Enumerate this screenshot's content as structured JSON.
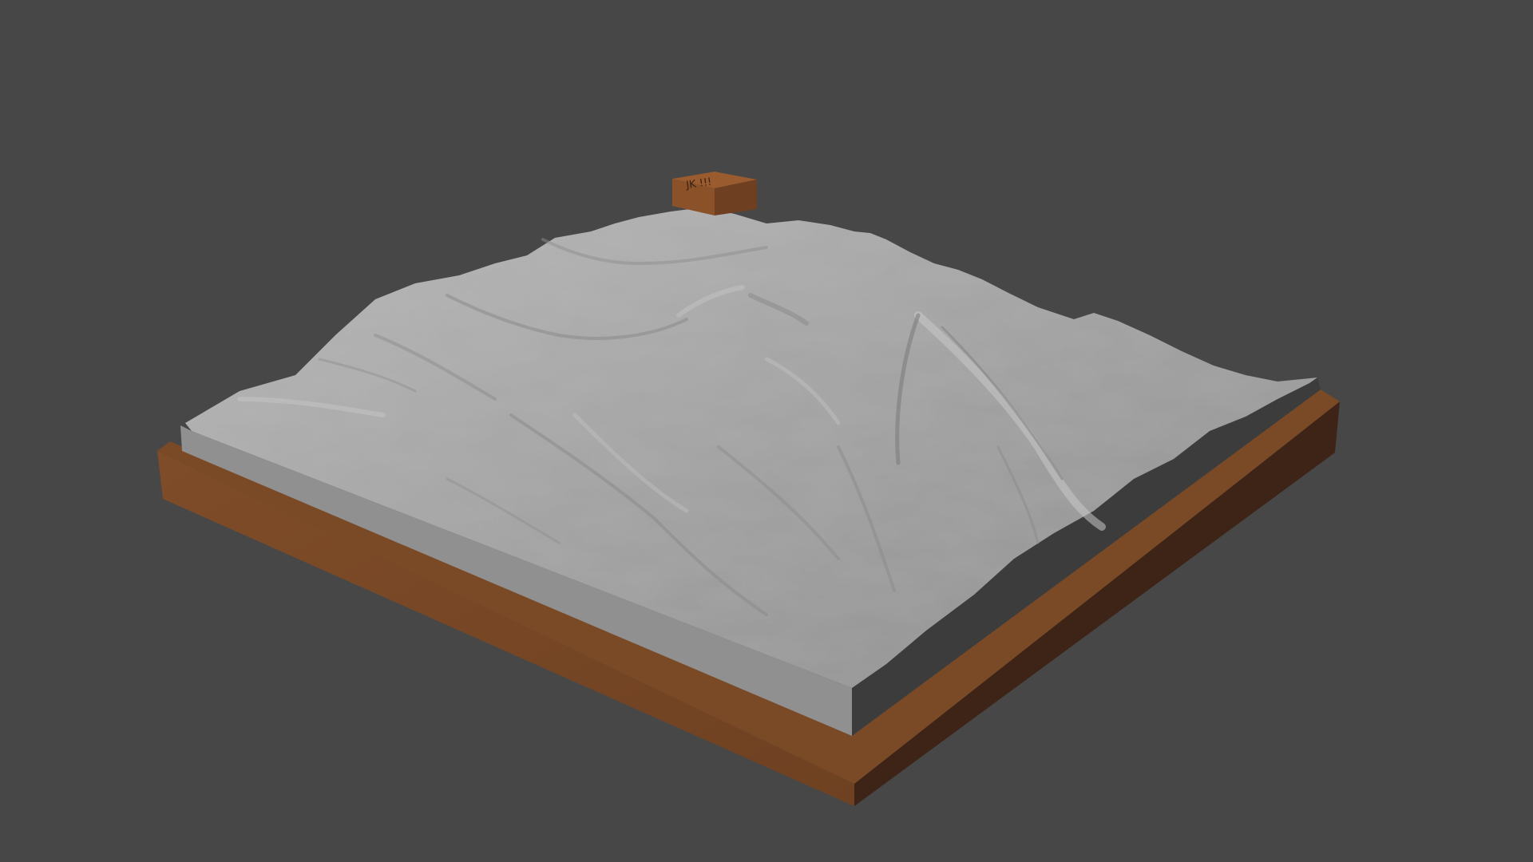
{
  "viewport": {
    "background_color": "#474747"
  },
  "scene": {
    "terrain_color": "#a6a6a6",
    "terrain_side_color": "#909090",
    "terrain_shadow_side_color": "#3c3c3c",
    "base_color": "#7a4a27",
    "base_dark_side_color": "#3d2417",
    "tag_box_color": "#8b5128",
    "tag_box_text": "JK !!!"
  }
}
